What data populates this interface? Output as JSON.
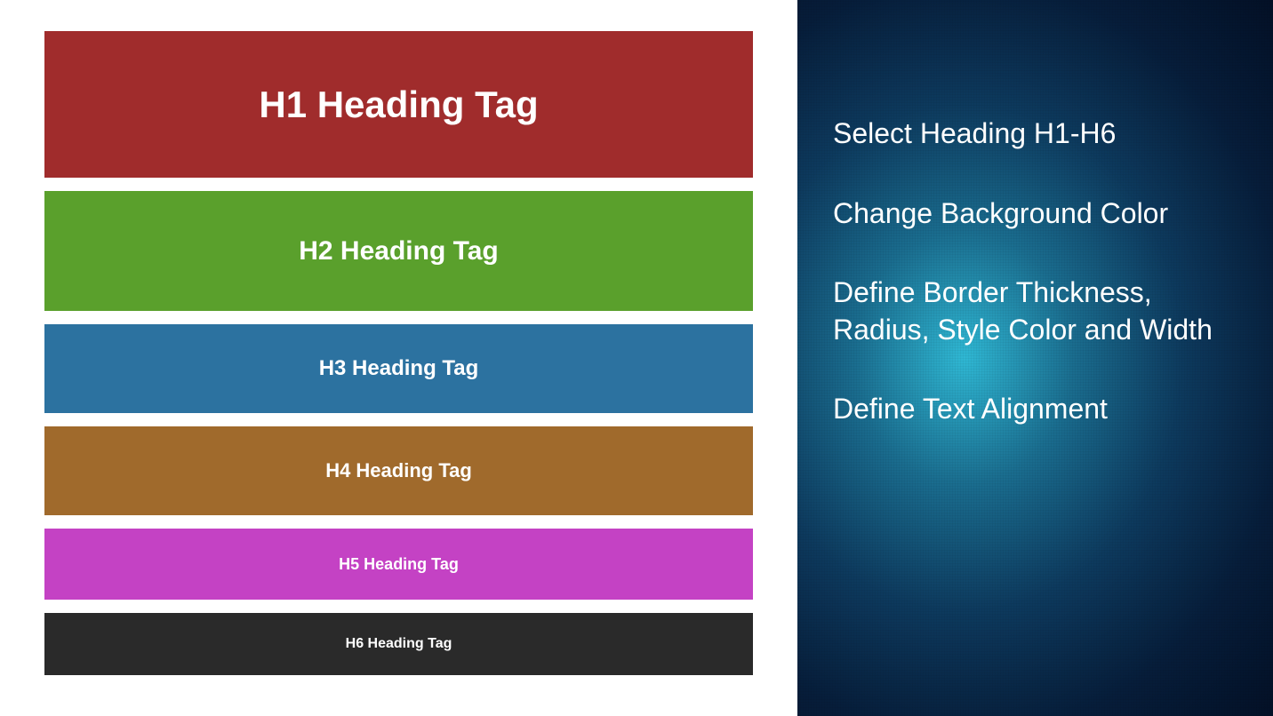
{
  "headings": {
    "h1": {
      "label": "H1 Heading Tag",
      "bg": "#a02c2c"
    },
    "h2": {
      "label": "H2 Heading Tag",
      "bg": "#5aa02c"
    },
    "h3": {
      "label": "H3 Heading Tag",
      "bg": "#2c72a0"
    },
    "h4": {
      "label": "H4 Heading Tag",
      "bg": "#a06a2c"
    },
    "h5": {
      "label": "H5 Heading Tag",
      "bg": "#c442c4"
    },
    "h6": {
      "label": "H6 Heading Tag",
      "bg": "#2a2a2a"
    }
  },
  "features": {
    "item1": "Select Heading H1-H6",
    "item2": "Change Background Color",
    "item3": "Define Border Thickness, Radius, Style Color and Width",
    "item4": "Define Text Alignment"
  }
}
